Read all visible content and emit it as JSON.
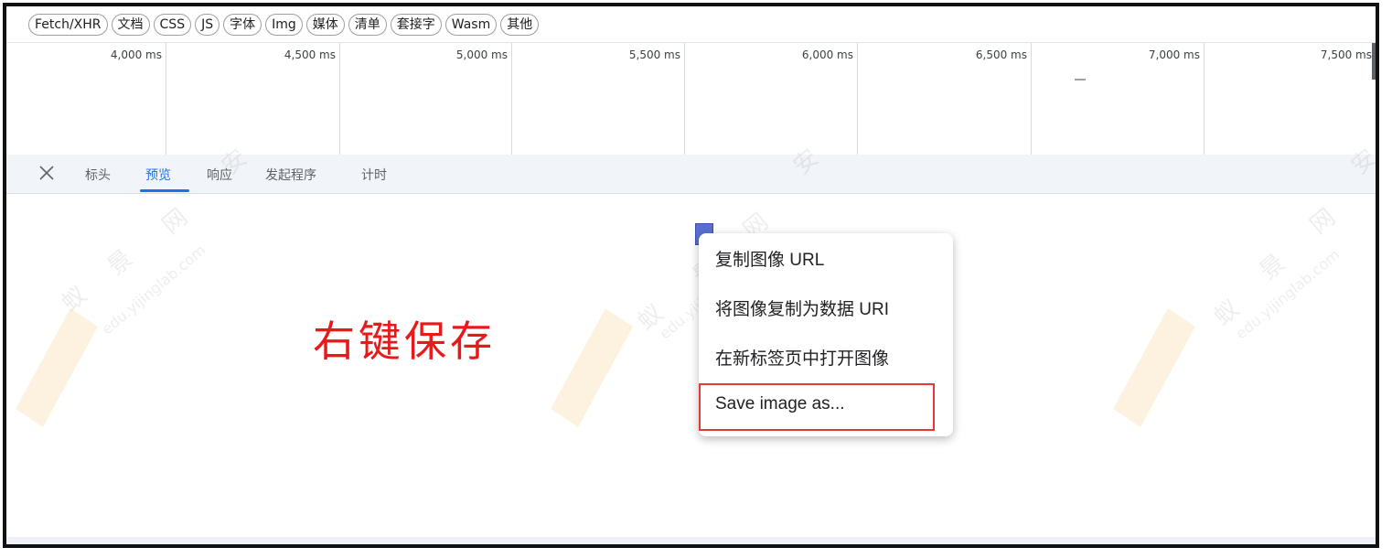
{
  "filters": [
    "Fetch/XHR",
    "文档",
    "CSS",
    "JS",
    "字体",
    "Img",
    "媒体",
    "清单",
    "套接字",
    "Wasm",
    "其他"
  ],
  "timeline": {
    "ticks": [
      "4,000 ms",
      "4,500 ms",
      "5,000 ms",
      "5,500 ms",
      "6,000 ms",
      "6,500 ms",
      "7,000 ms",
      "7,500 ms"
    ]
  },
  "tabs": {
    "close_icon": "close-icon",
    "items": [
      "标头",
      "预览",
      "响应",
      "发起程序",
      "计时"
    ],
    "active": "预览"
  },
  "preview": {
    "annotation": "右键保存"
  },
  "watermark": {
    "brand_chars": [
      "蚁",
      "景",
      "网",
      "安"
    ],
    "site": "edu.yijinglab.com"
  },
  "context_menu": {
    "items": [
      "复制图像 URL",
      "将图像复制为数据 URI",
      "在新标签页中打开图像",
      "Save image as..."
    ],
    "highlighted": "Save image as..."
  },
  "colors": {
    "accent": "#1a73e8",
    "annotation": "#e8191b",
    "highlight_border": "#e53935"
  }
}
